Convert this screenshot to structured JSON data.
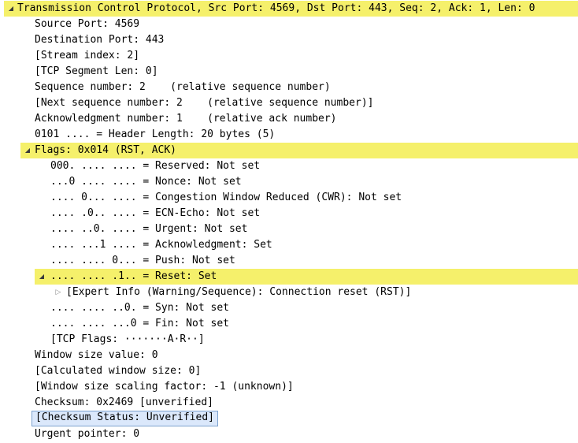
{
  "rows": [
    {
      "text": "Transmission Control Protocol, Src Port: 4569, Dst Port: 443, Seq: 2, Ack: 1, Len: 0",
      "expander": "down",
      "icon": "expanded-triangle-icon",
      "highlight": true
    },
    {
      "text": "Source Port: 4569"
    },
    {
      "text": "Destination Port: 443"
    },
    {
      "text": "[Stream index: 2]"
    },
    {
      "text": "[TCP Segment Len: 0]"
    },
    {
      "text": "Sequence number: 2    (relative sequence number)"
    },
    {
      "text": "[Next sequence number: 2    (relative sequence number)]"
    },
    {
      "text": "Acknowledgment number: 1    (relative ack number)"
    },
    {
      "text": "0101 .... = Header Length: 20 bytes (5)"
    },
    {
      "text": "Flags: 0x014 (RST, ACK)",
      "expander": "down",
      "icon": "expanded-triangle-icon",
      "highlight": true
    },
    {
      "text": "000. .... .... = Reserved: Not set"
    },
    {
      "text": "...0 .... .... = Nonce: Not set"
    },
    {
      "text": ".... 0... .... = Congestion Window Reduced (CWR): Not set"
    },
    {
      "text": ".... .0.. .... = ECN-Echo: Not set"
    },
    {
      "text": ".... ..0. .... = Urgent: Not set"
    },
    {
      "text": ".... ...1 .... = Acknowledgment: Set"
    },
    {
      "text": ".... .... 0... = Push: Not set"
    },
    {
      "text": ".... .... .1.. = Reset: Set",
      "expander": "down",
      "icon": "expanded-triangle-icon",
      "highlight": true
    },
    {
      "text": "[Expert Info (Warning/Sequence): Connection reset (RST)]",
      "expander": "right",
      "icon": "collapsed-triangle-icon"
    },
    {
      "text": ".... .... ..0. = Syn: Not set"
    },
    {
      "text": ".... .... ...0 = Fin: Not set"
    },
    {
      "text": "[TCP Flags: ·······A·R··]"
    },
    {
      "text": "Window size value: 0"
    },
    {
      "text": "[Calculated window size: 0]"
    },
    {
      "text": "[Window size scaling factor: -1 (unknown)]"
    },
    {
      "text": "Checksum: 0x2469 [unverified]"
    },
    {
      "text": "[Checksum Status: Unverified]",
      "selected": true
    },
    {
      "text": "Urgent pointer: 0"
    }
  ]
}
